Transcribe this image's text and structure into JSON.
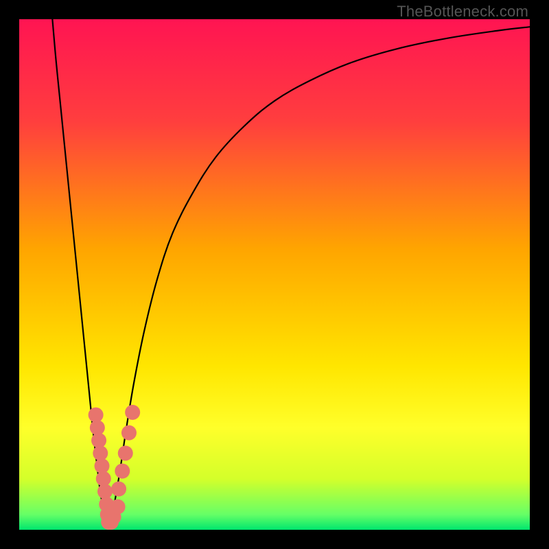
{
  "attribution": "TheBottleneck.com",
  "chart_data": {
    "type": "line",
    "title": "",
    "xlabel": "",
    "ylabel": "",
    "xlim": [
      0,
      100
    ],
    "ylim": [
      0,
      100
    ],
    "gradient_stops": [
      {
        "offset": 0,
        "color": "#ff1452"
      },
      {
        "offset": 20,
        "color": "#ff3e3e"
      },
      {
        "offset": 45,
        "color": "#ffa500"
      },
      {
        "offset": 68,
        "color": "#ffe600"
      },
      {
        "offset": 80,
        "color": "#ffff2a"
      },
      {
        "offset": 90,
        "color": "#d4ff2a"
      },
      {
        "offset": 97,
        "color": "#66ff66"
      },
      {
        "offset": 100,
        "color": "#00e66e"
      }
    ],
    "series": [
      {
        "name": "left-branch",
        "x": [
          6.5,
          7.2,
          8.0,
          9.0,
          10.0,
          11.0,
          12.0,
          13.0,
          13.8,
          14.5,
          15.2,
          15.8,
          16.3,
          16.8,
          17.2,
          17.5
        ],
        "values": [
          100,
          92,
          84,
          74,
          64,
          54,
          44,
          34,
          26,
          19,
          13,
          8,
          5,
          3,
          1.5,
          0.2
        ]
      },
      {
        "name": "right-branch",
        "x": [
          17.5,
          18.0,
          18.8,
          19.8,
          21.0,
          22.5,
          24.5,
          27.0,
          30.0,
          34.0,
          38.5,
          44.0,
          50.0,
          57.0,
          65.0,
          74.0,
          84.0,
          94.0,
          100.0
        ],
        "values": [
          0.2,
          2,
          6,
          12,
          20,
          29,
          39,
          49,
          58,
          66,
          73,
          79,
          84,
          88,
          91.5,
          94.2,
          96.3,
          97.8,
          98.5
        ]
      }
    ],
    "markers": [
      {
        "x": 15.0,
        "y": 22.5
      },
      {
        "x": 15.3,
        "y": 20.0
      },
      {
        "x": 15.6,
        "y": 17.5
      },
      {
        "x": 15.9,
        "y": 15.0
      },
      {
        "x": 16.2,
        "y": 12.5
      },
      {
        "x": 16.5,
        "y": 10.0
      },
      {
        "x": 16.8,
        "y": 7.5
      },
      {
        "x": 17.1,
        "y": 5.0
      },
      {
        "x": 17.3,
        "y": 3.0
      },
      {
        "x": 17.5,
        "y": 1.5
      },
      {
        "x": 18.0,
        "y": 1.5
      },
      {
        "x": 18.5,
        "y": 2.5
      },
      {
        "x": 19.3,
        "y": 4.5
      },
      {
        "x": 19.5,
        "y": 8.0
      },
      {
        "x": 20.2,
        "y": 11.5
      },
      {
        "x": 20.8,
        "y": 15.0
      },
      {
        "x": 21.5,
        "y": 19.0
      },
      {
        "x": 22.2,
        "y": 23.0
      }
    ],
    "marker_color": "#e8746d",
    "marker_radius": 11,
    "curve_color": "#000000",
    "curve_width": 2.2
  }
}
